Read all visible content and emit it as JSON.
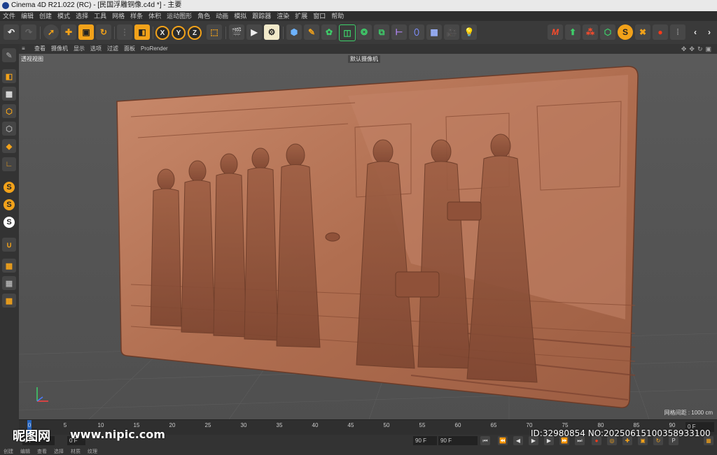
{
  "window": {
    "title": "Cinema 4D R21.022 (RC) - [民国浮雕铜像.c4d *] - 主要"
  },
  "menubar": {
    "items": [
      "文件",
      "编辑",
      "创建",
      "模式",
      "选择",
      "工具",
      "网格",
      "样条",
      "体积",
      "运动图形",
      "角色",
      "动画",
      "模拟",
      "跟踪器",
      "渲染",
      "扩展",
      "窗口",
      "帮助"
    ]
  },
  "toolbar": {
    "icons": [
      "undo-icon",
      "redo-icon",
      "select-icon",
      "move-icon",
      "scale-icon",
      "rotate-icon",
      "recent-icon",
      "model-mode-icon",
      "x-axis-icon",
      "y-axis-icon",
      "z-axis-icon",
      "coordinate-icon",
      "render-region-icon",
      "render-view-icon",
      "render-settings-icon",
      "cube-icon",
      "pen-icon",
      "subdivision-icon",
      "extrude-icon",
      "array-icon",
      "instance-icon",
      "deformer-icon",
      "scene-icon",
      "floor-icon",
      "camera-icon",
      "light-icon"
    ],
    "axis_labels": [
      "X",
      "Y",
      "Z"
    ],
    "right_icons": [
      "mograph-icon",
      "character-icon",
      "motion-icon",
      "dynamics-icon",
      "sketch-icon",
      "snap-icon",
      "paint-icon",
      "layout-icon",
      "nav-prev-icon",
      "nav-next-icon"
    ]
  },
  "viewport_menu": {
    "items": [
      "查看",
      "摄像机",
      "显示",
      "选项",
      "过滤",
      "面板",
      "ProRender"
    ]
  },
  "viewport": {
    "view_name": "透视视图",
    "camera": "默认摄像机",
    "grid_spacing": "网格间距 : 1000 cm"
  },
  "timeline": {
    "ticks": [
      "0",
      "5",
      "10",
      "15",
      "20",
      "25",
      "30",
      "35",
      "40",
      "45",
      "50",
      "55",
      "60",
      "65",
      "70",
      "75",
      "80",
      "85",
      "90"
    ],
    "current_frame": "0 F"
  },
  "transport": {
    "start_field": "0 F",
    "start_field2": "0 F",
    "end_field": "90 F",
    "end_field2": "90 F"
  },
  "bottom_tabs": [
    "创建",
    "编辑",
    "查看",
    "选择",
    "材质",
    "纹理"
  ],
  "watermark": {
    "logo": "昵图网",
    "url": "www.nipic.com",
    "id_text": "ID:32980854 NO:20250615100358933100"
  },
  "colors": {
    "accent_orange": "#f2a21a",
    "bronze": "#b06e50",
    "playhead_blue": "#2566c4"
  }
}
